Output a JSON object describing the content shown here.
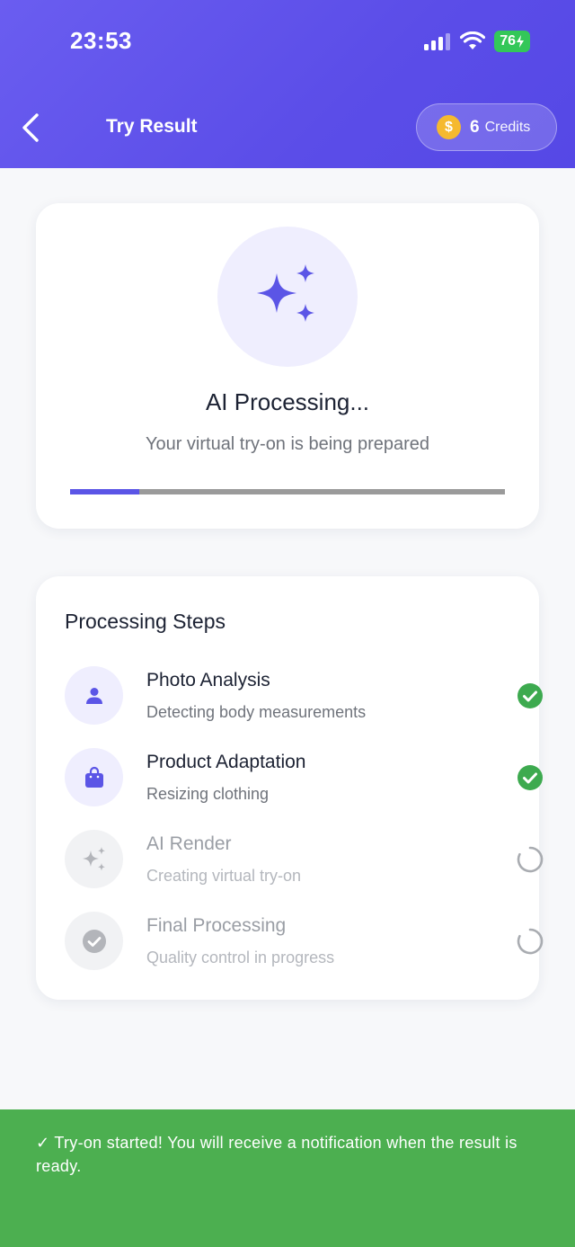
{
  "status_bar": {
    "time": "23:53",
    "battery": "76"
  },
  "header": {
    "title": "Try Result",
    "credits_count": "6",
    "credits_label": "Credits",
    "coin_symbol": "$"
  },
  "processing": {
    "title": "AI Processing...",
    "subtitle": "Your virtual try-on is being prepared",
    "progress_percent": 16
  },
  "steps_section": {
    "title": "Processing Steps",
    "steps": [
      {
        "name": "Photo Analysis",
        "description": "Detecting body measurements",
        "status": "done",
        "icon": "person-icon"
      },
      {
        "name": "Product Adaptation",
        "description": "Resizing clothing",
        "status": "done",
        "icon": "shopping-bag-icon"
      },
      {
        "name": "AI Render",
        "description": "Creating virtual try-on",
        "status": "pending",
        "icon": "sparkles-icon"
      },
      {
        "name": "Final Processing",
        "description": "Quality control in progress",
        "status": "pending",
        "icon": "check-circle-icon"
      }
    ]
  },
  "toast": {
    "message": "✓ Try-on started! You will receive a notification when the result is ready."
  },
  "colors": {
    "accent": "#5b55e6",
    "success": "#4caf50",
    "check_green": "#3daa4f"
  }
}
